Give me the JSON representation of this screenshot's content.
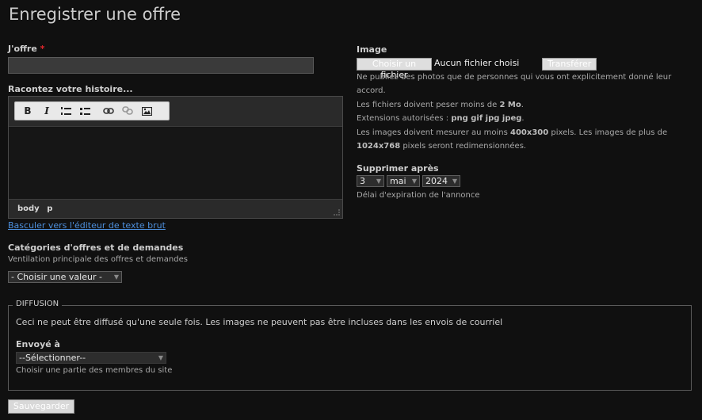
{
  "page": {
    "title": "Enregistrer une offre"
  },
  "offer": {
    "label": "J'offre",
    "required_mark": "*",
    "value": ""
  },
  "story": {
    "label": "Racontez votre histoire...",
    "toolbar": [
      "bold",
      "italic",
      "ordered-list",
      "bullet-list",
      "link",
      "unlink",
      "image"
    ],
    "toolbar_labels": {
      "bold": "B",
      "italic": "I"
    },
    "path": [
      "body",
      "p"
    ],
    "switch_link": "Basculer vers l'éditeur de texte brut"
  },
  "categories": {
    "label": "Catégories d'offres et de demandes",
    "help": "Ventilation principale des offres et demandes",
    "select_value": "- Choisir une valeur -"
  },
  "image": {
    "label": "Image",
    "choose_button": "Choisir un fichier",
    "no_file": "Aucun fichier choisi",
    "upload_button": "Transférer",
    "help1": "Ne publiez des photos que de personnes qui vous ont explicitement donné leur accord.",
    "help2_pre": "Les fichiers doivent peser moins de ",
    "help2_bold": "2 Mo",
    "help2_post": ".",
    "help3_pre": "Extensions autorisées : ",
    "help3_bold": "png gif jpg jpeg",
    "help3_post": ".",
    "help4_pre": "Les images doivent mesurer au moins ",
    "help4_bold1": "400x300",
    "help4_mid": " pixels. Les images de plus de ",
    "help4_bold2": "1024x768",
    "help4_post": " pixels seront redimensionnées."
  },
  "expiry": {
    "label": "Supprimer après",
    "day": "3",
    "month": "mai",
    "year": "2024",
    "help": "Délai d'expiration de l'annonce"
  },
  "diffusion": {
    "legend": "DIFFUSION",
    "notice": "Ceci ne peut être diffusé qu'une seule fois. Les images ne peuvent pas être incluses dans les envois de courriel",
    "sent_label": "Envoyé à",
    "select_value": "--Sélectionner--",
    "help": "Choisir une partie des membres du site"
  },
  "actions": {
    "save": "Sauvegarder"
  }
}
